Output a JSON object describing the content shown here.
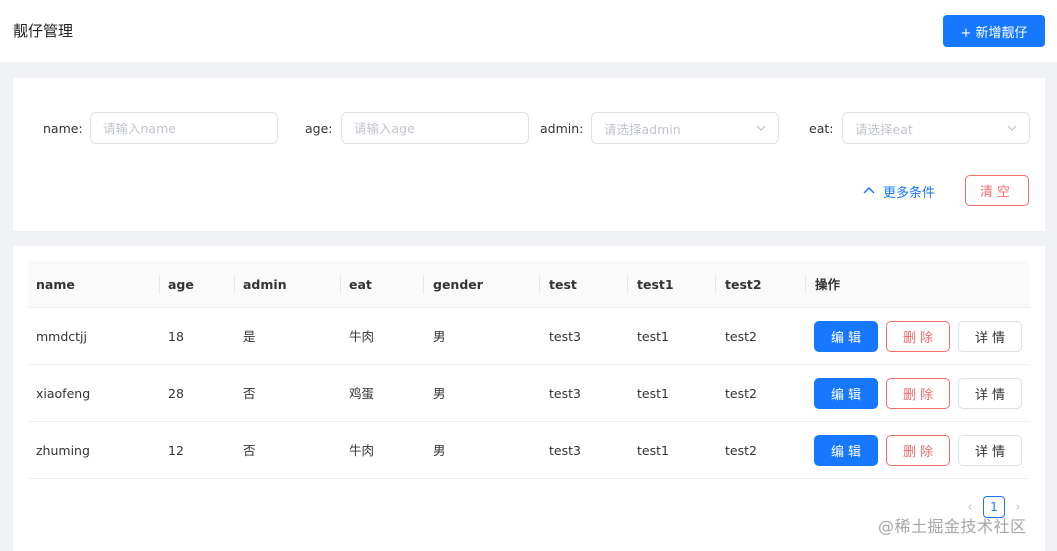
{
  "header": {
    "title": "靓仔管理",
    "add_button": "+ 新增靓仔"
  },
  "filters": {
    "name": {
      "label": "name:",
      "placeholder": "请输入name"
    },
    "age": {
      "label": "age:",
      "placeholder": "请输入age"
    },
    "admin": {
      "label": "admin:",
      "placeholder": "请选择admin"
    },
    "eat": {
      "label": "eat:",
      "placeholder": "请选择eat"
    },
    "more_label": "更多条件",
    "clear_label": "清空"
  },
  "table": {
    "columns": [
      "name",
      "age",
      "admin",
      "eat",
      "gender",
      "test",
      "test1",
      "test2",
      "操作"
    ],
    "rows": [
      {
        "name": "mmdctjj",
        "age": "18",
        "admin": "是",
        "eat": "牛肉",
        "gender": "男",
        "test": "test3",
        "test1": "test1",
        "test2": "test2"
      },
      {
        "name": "xiaofeng",
        "age": "28",
        "admin": "否",
        "eat": "鸡蛋",
        "gender": "男",
        "test": "test3",
        "test1": "test1",
        "test2": "test2"
      },
      {
        "name": "zhuming",
        "age": "12",
        "admin": "否",
        "eat": "牛肉",
        "gender": "男",
        "test": "test3",
        "test1": "test1",
        "test2": "test2"
      }
    ],
    "actions": {
      "edit": "编辑",
      "delete": "删除",
      "detail": "详情"
    }
  },
  "pagination": {
    "current": "1",
    "prev": "‹",
    "next": "›"
  },
  "watermark": "@稀土掘金技术社区",
  "colors": {
    "primary": "#1677ff",
    "danger": "#f56c6c",
    "background": "#f0f2f5"
  }
}
